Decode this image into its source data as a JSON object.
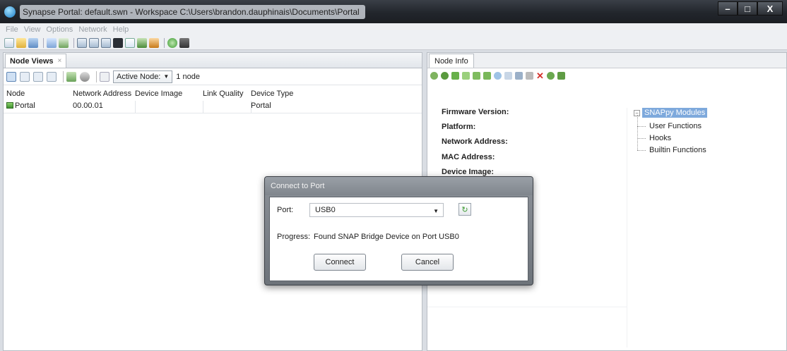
{
  "window": {
    "title": "Synapse Portal: default.swn - Workspace C:\\Users\\brandon.dauphinais\\Documents\\Portal",
    "controls": {
      "minimize": "–",
      "maximize": "□",
      "close": "X"
    }
  },
  "menu": {
    "items": [
      "File",
      "View",
      "Options",
      "Network",
      "Help"
    ]
  },
  "left_pane": {
    "tab_label": "Node Views",
    "tab_close": "×",
    "active_filter": "Active Node:",
    "node_count": "1 node",
    "columns": [
      "Node",
      "Network Address",
      "Device Image",
      "Link Quality",
      "Device Type"
    ],
    "rows": [
      {
        "node": "Portal",
        "network_address": "00.00.01",
        "device_image": "",
        "link_quality": "",
        "device_type": "Portal"
      }
    ]
  },
  "right_pane": {
    "tab_label": "Node Info",
    "fields": [
      "Firmware Version:",
      "Platform:",
      "Network Address:",
      "MAC Address:",
      "Device Image:"
    ],
    "tree": {
      "root": "SNAPpy Modules",
      "children": [
        "User Functions",
        "Hooks",
        "Builtin Functions"
      ]
    }
  },
  "dialog": {
    "title": "Connect to Port",
    "port_label": "Port:",
    "port_value": "USB0",
    "progress_label": "Progress:",
    "progress_text": "Found SNAP Bridge Device on Port USB0",
    "connect_label": "Connect",
    "cancel_label": "Cancel"
  },
  "colors": {
    "title_bar": "#22262c",
    "tree_selection": "#7ea9dc",
    "dialog_frame": "#7a8087"
  }
}
